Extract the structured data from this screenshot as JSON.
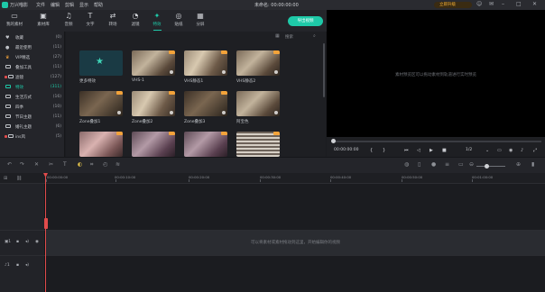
{
  "app": {
    "name": "万兴喵影",
    "menu": [
      "文件",
      "编辑",
      "剪辑",
      "显示",
      "帮助"
    ],
    "title": "未命名: 00:00:00:00",
    "buy_button": "立即升级"
  },
  "toolbar": {
    "tabs": [
      {
        "label": "我的素材",
        "icon": "folder-icon"
      },
      {
        "label": "素材库",
        "icon": "library-icon"
      },
      {
        "label": "音频",
        "icon": "music-icon"
      },
      {
        "label": "文字",
        "icon": "text-icon"
      },
      {
        "label": "转场",
        "icon": "transition-icon"
      },
      {
        "label": "滤镜",
        "icon": "filter-icon"
      },
      {
        "label": "特效",
        "icon": "effects-icon"
      },
      {
        "label": "贴纸",
        "icon": "sticker-icon"
      },
      {
        "label": "分屏",
        "icon": "split-screen-icon"
      }
    ],
    "active_tab": "特效",
    "export_label": "导出视频"
  },
  "sidebar": {
    "items": [
      {
        "name": "收藏",
        "count": "(0)"
      },
      {
        "name": "最近使用",
        "count": "(11)"
      },
      {
        "name": "VIP精选",
        "count": "(27)"
      },
      {
        "name": "叠加工具",
        "count": "(11)"
      },
      {
        "name": "滤镜",
        "count": "(127)"
      },
      {
        "name": "特效",
        "count": "(311)"
      },
      {
        "name": "生活方式",
        "count": "(16)"
      },
      {
        "name": "四季",
        "count": "(10)"
      },
      {
        "name": "节日主题",
        "count": "(11)"
      },
      {
        "name": "婚礼主题",
        "count": "(6)"
      },
      {
        "name": "ins风",
        "count": "(5)"
      }
    ],
    "active": "特效"
  },
  "grid": {
    "search_placeholder": "搜索",
    "items": [
      {
        "label": "更多特效"
      },
      {
        "label": "VHS-1"
      },
      {
        "label": "VHS静态1"
      },
      {
        "label": "VHS静态2"
      },
      {
        "label": "Zone叠加1"
      },
      {
        "label": "Zone叠加2"
      },
      {
        "label": "Zone叠加3"
      },
      {
        "label": "阿宝色"
      },
      {
        "label": ""
      },
      {
        "label": ""
      },
      {
        "label": ""
      },
      {
        "label": ""
      }
    ]
  },
  "preview": {
    "hint": "素材预览区可以拖动素材到轨道进行实时预览",
    "timecode": "00:00:00:00",
    "page": "1/2"
  },
  "timeline": {
    "ruler_labels": [
      "00:00:00:00",
      "00:00:10:00",
      "00:00:20:00",
      "00:00:30:00",
      "00:00:40:00",
      "00:00:50:00",
      "00:01:00:00"
    ],
    "drop_hint": "可以将素材或素材拖动到这里，开始编辑你的视频"
  }
}
